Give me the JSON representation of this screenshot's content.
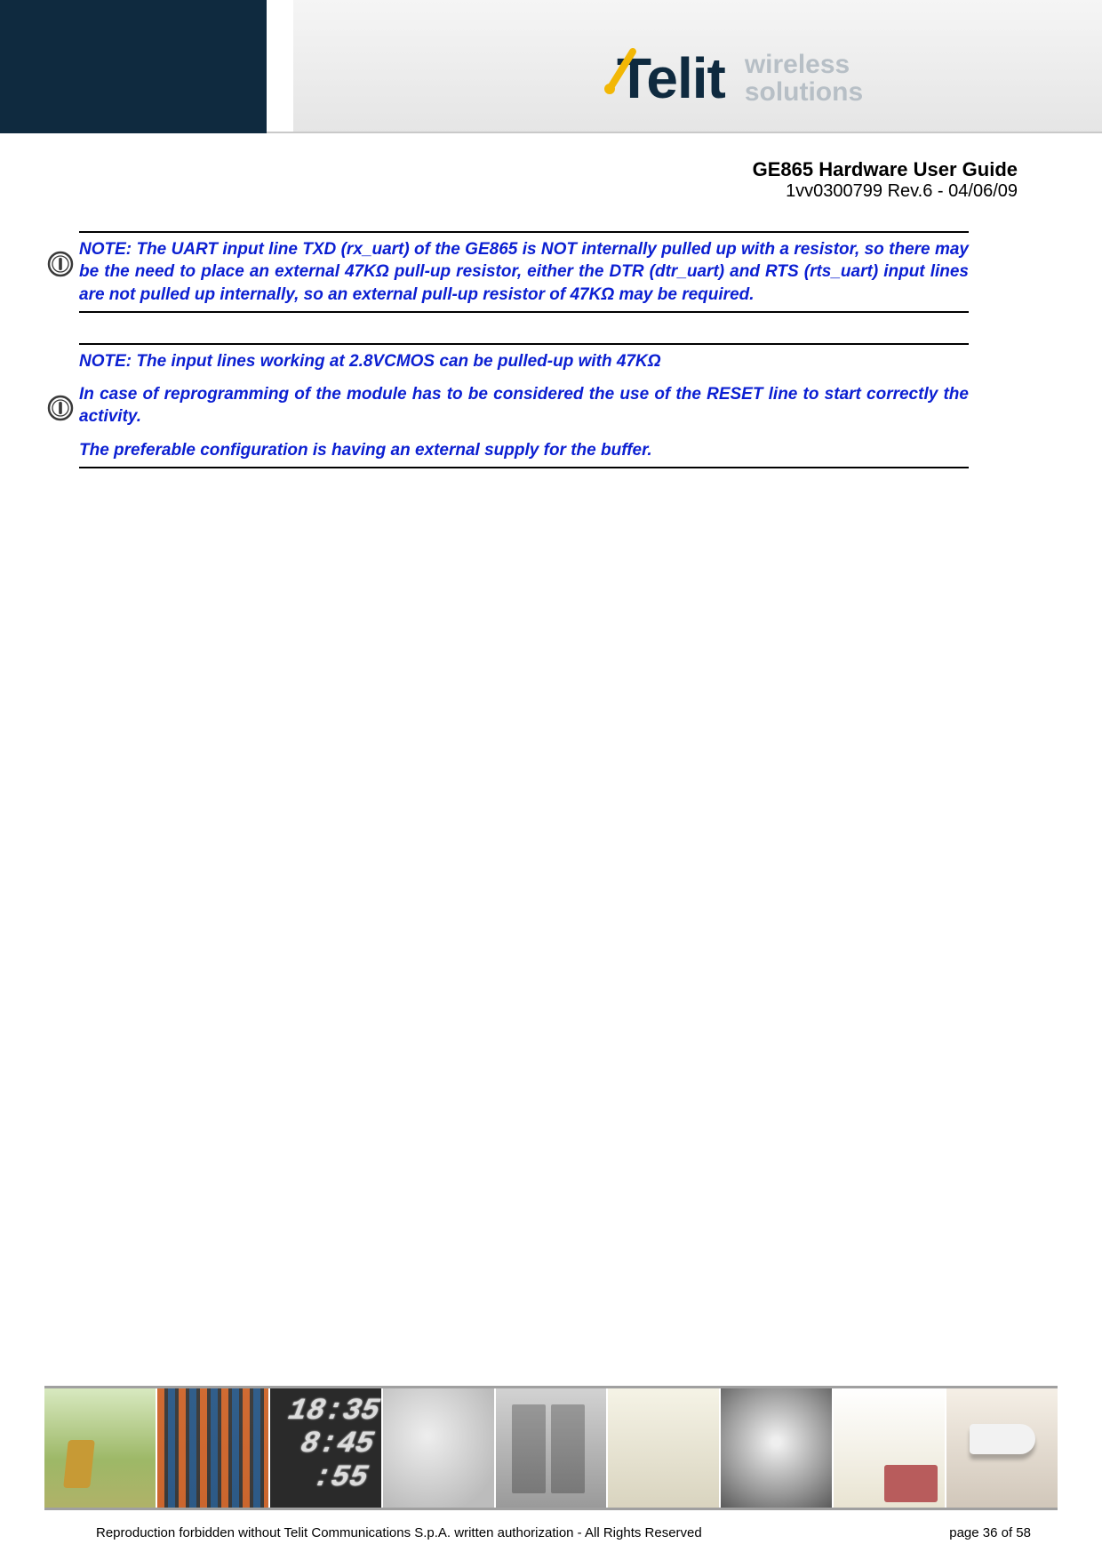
{
  "header": {
    "brand_word": "Telit",
    "tagline_line1": "wireless",
    "tagline_line2": "solutions"
  },
  "doc": {
    "title": "GE865 Hardware User Guide",
    "revision": "1vv0300799 Rev.6 - 04/06/09"
  },
  "notes": [
    {
      "paragraphs": [
        "NOTE: The UART input line TXD (rx_uart) of the GE865 is NOT internally pulled up with a  resistor, so there may be the need to place an external 47KΩ pull-up resistor, either the DTR (dtr_uart) and RTS (rts_uart) input lines are not pulled up internally, so an external pull-up resistor of 47KΩ may be required."
      ]
    },
    {
      "paragraphs": [
        "NOTE: The input lines working at 2.8VCMOS can be pulled-up with 47KΩ",
        "In case of reprogramming of the module has to be considered the use of the RESET line to start correctly the activity.",
        "The preferable configuration is having an external supply for the buffer."
      ]
    }
  ],
  "lcd": {
    "line1": "18:35",
    "line2": "8:45",
    "line3": ":55"
  },
  "footer": {
    "copyright": "Reproduction forbidden without Telit Communications S.p.A. written authorization - All Rights Reserved",
    "page_label": "page 36 of 58"
  }
}
